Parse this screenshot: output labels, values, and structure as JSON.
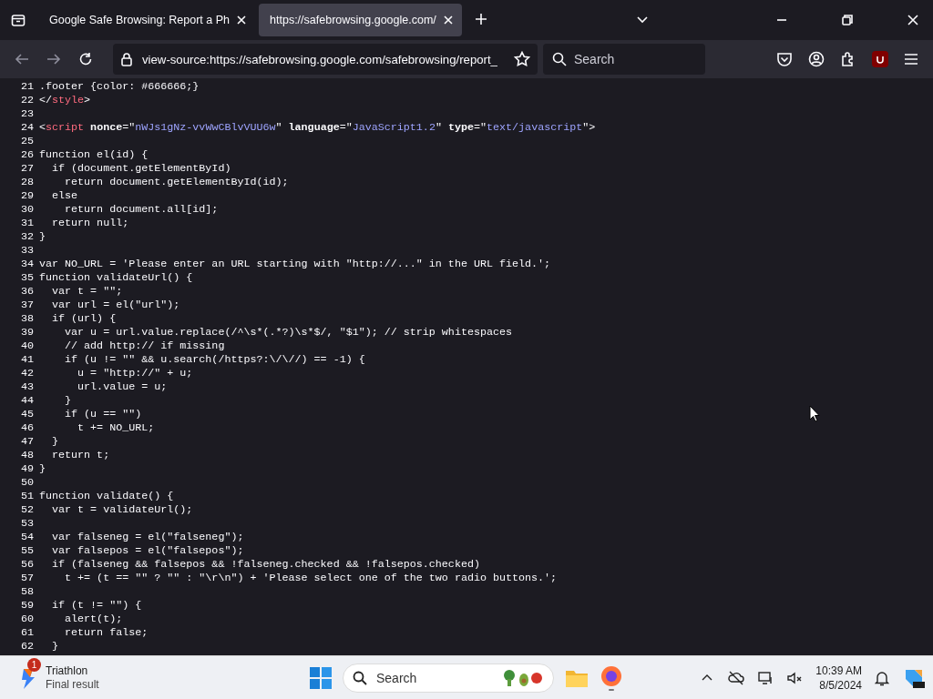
{
  "tabs": [
    {
      "title": "Google Safe Browsing: Report a Ph",
      "selected": false
    },
    {
      "title": "https://safebrowsing.google.com/",
      "selected": true
    }
  ],
  "toolbar": {
    "url": "view-source:https://safebrowsing.google.com/safebrowsing/report_",
    "search_placeholder": "Search"
  },
  "source_lines": [
    {
      "number": "21",
      "segments": [
        {
          "kind": "text",
          "text": ".footer {color: #666666;}"
        }
      ]
    },
    {
      "number": "22",
      "segments": [
        {
          "kind": "text",
          "text": "</"
        },
        {
          "kind": "tag",
          "text": "style"
        },
        {
          "kind": "text",
          "text": ">"
        }
      ]
    },
    {
      "number": "23"
    },
    {
      "number": "24",
      "segments": [
        {
          "kind": "text",
          "text": "<"
        },
        {
          "kind": "tag",
          "text": "script"
        },
        {
          "kind": "attr",
          "text": " nonce"
        },
        {
          "kind": "text",
          "text": "=\""
        },
        {
          "kind": "value",
          "text": "nWJs1gNz-vvWwCBlvVUU6w"
        },
        {
          "kind": "text",
          "text": "\" "
        },
        {
          "kind": "attr",
          "text": "language"
        },
        {
          "kind": "text",
          "text": "=\""
        },
        {
          "kind": "value",
          "text": "JavaScript1.2"
        },
        {
          "kind": "text",
          "text": "\" "
        },
        {
          "kind": "attr",
          "text": "type"
        },
        {
          "kind": "text",
          "text": "=\""
        },
        {
          "kind": "value",
          "text": "text/javascript"
        },
        {
          "kind": "text",
          "text": "\">"
        }
      ]
    },
    {
      "number": "25"
    },
    {
      "number": "26",
      "segments": [
        {
          "kind": "text",
          "text": "function el(id) {"
        }
      ]
    },
    {
      "number": "27",
      "segments": [
        {
          "kind": "text",
          "text": "  if (document.getElementById)"
        }
      ]
    },
    {
      "number": "28",
      "segments": [
        {
          "kind": "text",
          "text": "    return document.getElementById(id);"
        }
      ]
    },
    {
      "number": "29",
      "segments": [
        {
          "kind": "text",
          "text": "  else"
        }
      ]
    },
    {
      "number": "30",
      "segments": [
        {
          "kind": "text",
          "text": "    return document.all[id];"
        }
      ]
    },
    {
      "number": "31",
      "segments": [
        {
          "kind": "text",
          "text": "  return null;"
        }
      ]
    },
    {
      "number": "32",
      "segments": [
        {
          "kind": "text",
          "text": "}"
        }
      ]
    },
    {
      "number": "33"
    },
    {
      "number": "34",
      "segments": [
        {
          "kind": "text",
          "text": "var NO_URL = 'Please enter an URL starting with \"http://...\" in the URL field.';"
        }
      ]
    },
    {
      "number": "35",
      "segments": [
        {
          "kind": "text",
          "text": "function validateUrl() {"
        }
      ]
    },
    {
      "number": "36",
      "segments": [
        {
          "kind": "text",
          "text": "  var t = \"\";"
        }
      ]
    },
    {
      "number": "37",
      "segments": [
        {
          "kind": "text",
          "text": "  var url = el(\"url\");"
        }
      ]
    },
    {
      "number": "38",
      "segments": [
        {
          "kind": "text",
          "text": "  if (url) {"
        }
      ]
    },
    {
      "number": "39",
      "segments": [
        {
          "kind": "text",
          "text": "    var u = url.value.replace(/^\\s*(.*?)\\s*$/, \"$1\"); // strip whitespaces"
        }
      ]
    },
    {
      "number": "40",
      "segments": [
        {
          "kind": "text",
          "text": "    // add http:// if missing"
        }
      ]
    },
    {
      "number": "41",
      "segments": [
        {
          "kind": "text",
          "text": "    if (u != \"\" && u.search(/https?:\\/\\//) == -1) {"
        }
      ]
    },
    {
      "number": "42",
      "segments": [
        {
          "kind": "text",
          "text": "      u = \"http://\" + u;"
        }
      ]
    },
    {
      "number": "43",
      "segments": [
        {
          "kind": "text",
          "text": "      url.value = u;"
        }
      ]
    },
    {
      "number": "44",
      "segments": [
        {
          "kind": "text",
          "text": "    }"
        }
      ]
    },
    {
      "number": "45",
      "segments": [
        {
          "kind": "text",
          "text": "    if (u == \"\")"
        }
      ]
    },
    {
      "number": "46",
      "segments": [
        {
          "kind": "text",
          "text": "      t += NO_URL;"
        }
      ]
    },
    {
      "number": "47",
      "segments": [
        {
          "kind": "text",
          "text": "  }"
        }
      ]
    },
    {
      "number": "48",
      "segments": [
        {
          "kind": "text",
          "text": "  return t;"
        }
      ]
    },
    {
      "number": "49",
      "segments": [
        {
          "kind": "text",
          "text": "}"
        }
      ]
    },
    {
      "number": "50"
    },
    {
      "number": "51",
      "segments": [
        {
          "kind": "text",
          "text": "function validate() {"
        }
      ]
    },
    {
      "number": "52",
      "segments": [
        {
          "kind": "text",
          "text": "  var t = validateUrl();"
        }
      ]
    },
    {
      "number": "53"
    },
    {
      "number": "54",
      "segments": [
        {
          "kind": "text",
          "text": "  var falseneg = el(\"falseneg\");"
        }
      ]
    },
    {
      "number": "55",
      "segments": [
        {
          "kind": "text",
          "text": "  var falsepos = el(\"falsepos\");"
        }
      ]
    },
    {
      "number": "56",
      "segments": [
        {
          "kind": "text",
          "text": "  if (falseneg && falsepos && !falseneg.checked && !falsepos.checked)"
        }
      ]
    },
    {
      "number": "57",
      "segments": [
        {
          "kind": "text",
          "text": "    t += (t == \"\" ? \"\" : \"\\r\\n\") + 'Please select one of the two radio buttons.';"
        }
      ]
    },
    {
      "number": "58"
    },
    {
      "number": "59",
      "segments": [
        {
          "kind": "text",
          "text": "  if (t != \"\") {"
        }
      ]
    },
    {
      "number": "60",
      "segments": [
        {
          "kind": "text",
          "text": "    alert(t);"
        }
      ]
    },
    {
      "number": "61",
      "segments": [
        {
          "kind": "text",
          "text": "    return false;"
        }
      ]
    },
    {
      "number": "62",
      "segments": [
        {
          "kind": "text",
          "text": "  }"
        }
      ]
    }
  ],
  "taskbar": {
    "notification": {
      "badge": "1",
      "title": "Triathlon",
      "subtitle": "Final result"
    },
    "search_placeholder": "Search",
    "time": "10:39 AM",
    "date": "8/5/2024"
  }
}
